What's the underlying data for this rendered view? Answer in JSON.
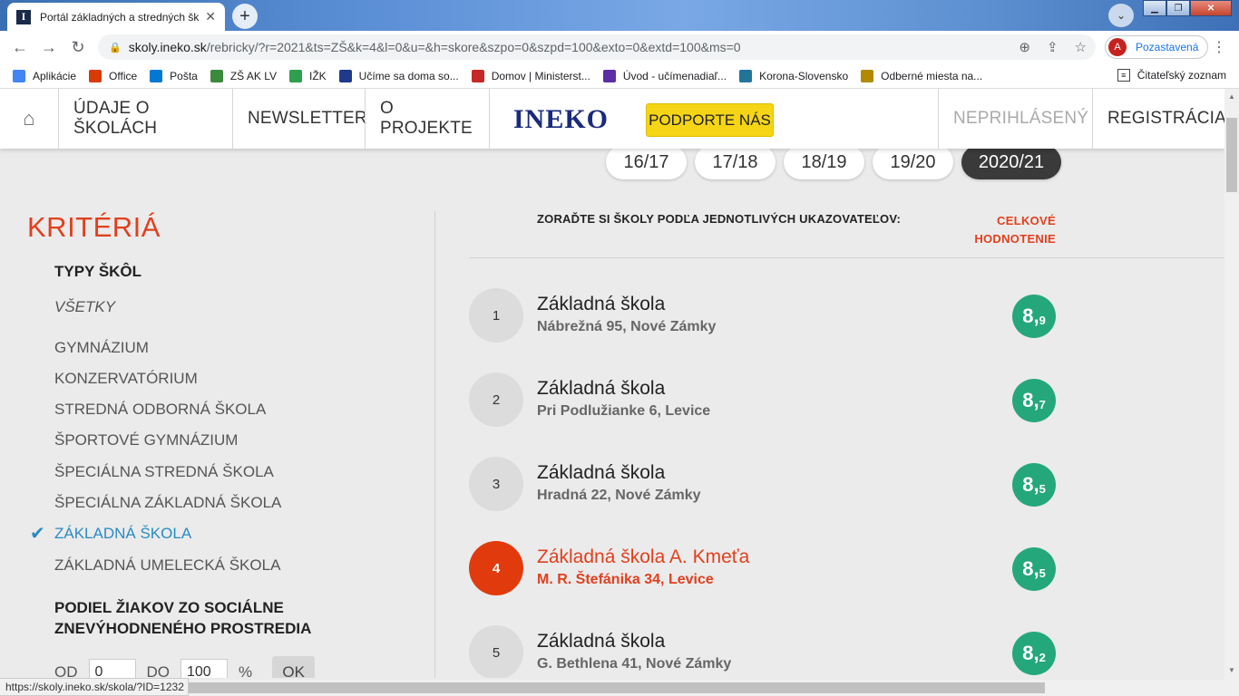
{
  "browser": {
    "tab_title": "Portál základných a stredných šk",
    "tab_favicon": "I",
    "url_host": "skoly.ineko.sk",
    "url_rest": "/rebricky/?r=2021&ts=ZŠ&k=4&l=0&u=&h=skore&szpo=0&szpd=100&exto=0&extd=100&ms=0",
    "profile_initial": "A",
    "profile_label": "Pozastavená",
    "bookmarks": [
      {
        "label": "Aplikácie",
        "icon": "apps-grid-icon",
        "color": "#4285f4"
      },
      {
        "label": "Office",
        "icon": "office-icon",
        "color": "#d83b01"
      },
      {
        "label": "Pošta",
        "icon": "outlook-icon",
        "color": "#0078d4"
      },
      {
        "label": "ZŠ AK LV",
        "icon": "school-logo-icon",
        "color": "#3c8a3c"
      },
      {
        "label": "IŽK",
        "icon": "izk-icon",
        "color": "#2e9e4f"
      },
      {
        "label": "Učíme sa doma so...",
        "icon": "globe-icon",
        "color": "#1f3a8a"
      },
      {
        "label": "Domov | Ministerst...",
        "icon": "sk-emblem-icon",
        "color": "#c62828"
      },
      {
        "label": "Úvod - učímenadiaľ...",
        "icon": "u-circle-icon",
        "color": "#5b2ea6"
      },
      {
        "label": "Korona-Slovensko",
        "icon": "wordpress-icon",
        "color": "#21759b"
      },
      {
        "label": "Odberné miesta na...",
        "icon": "crest-icon",
        "color": "#b08a00"
      }
    ],
    "reading_list": "Čitateľský zoznam",
    "status_url": "https://skoly.ineko.sk/skola/?ID=1232"
  },
  "header": {
    "nav": [
      "ÚDAJE O ŠKOLÁCH",
      "NEWSLETTER",
      "O PROJEKTE"
    ],
    "logo": "INEKO",
    "support_label": "PODPORTE NÁS",
    "login_status": "NEPRIHLÁSENÝ",
    "register_label": "REGISTRÁCIA"
  },
  "years": [
    "16/17",
    "17/18",
    "18/19",
    "19/20",
    "2020/21"
  ],
  "active_year": "2020/21",
  "sidebar": {
    "title": "KRITÉRIÁ",
    "types_heading": "TYPY ŠKÔL",
    "types": [
      {
        "label": "VŠETKY",
        "style": "italic"
      },
      {
        "label": "GYMNÁZIUM"
      },
      {
        "label": "KONZERVATÓRIUM"
      },
      {
        "label": "STREDNÁ ODBORNÁ ŠKOLA"
      },
      {
        "label": "ŠPORTOVÉ GYMNÁZIUM"
      },
      {
        "label": "ŠPECIÁLNA STREDNÁ ŠKOLA"
      },
      {
        "label": "ŠPECIÁLNA ZÁKLADNÁ ŠKOLA"
      },
      {
        "label": "ZÁKLADNÁ ŠKOLA",
        "checked": true
      },
      {
        "label": "ZÁKLADNÁ UMELECKÁ ŠKOLA"
      }
    ],
    "social_heading_line1": "PODIEL ŽIAKOV ZO SOCIÁLNE",
    "social_heading_line2": "ZNEVÝHODNENÉHO PROSTREDIA",
    "from_label": "OD",
    "from_value": "0",
    "to_label": "DO",
    "to_value": "100",
    "unit": "%",
    "ok_label": "OK"
  },
  "results": {
    "sort_label": "ZORAĎTE SI ŠKOLY PODĽA JEDNOTLIVÝCH UKAZOVATEĽOV:",
    "overall_line1": "CELKOVÉ",
    "overall_line2": "HODNOTENIE",
    "rows": [
      {
        "rank": "1",
        "name": "Základná škola",
        "address": "Nábrežná 95, Nové Zámky",
        "score_int": "8,",
        "score_dec": "9"
      },
      {
        "rank": "2",
        "name": "Základná škola",
        "address": "Pri Podlužianke 6, Levice",
        "score_int": "8,",
        "score_dec": "7"
      },
      {
        "rank": "3",
        "name": "Základná škola",
        "address": "Hradná 22, Nové Zámky",
        "score_int": "8,",
        "score_dec": "5"
      },
      {
        "rank": "4",
        "name": "Základná škola A. Kmeťa",
        "address": "M. R. Štefánika 34, Levice",
        "score_int": "8,",
        "score_dec": "5",
        "highlight": true
      },
      {
        "rank": "5",
        "name": "Základná škola",
        "address": "G. Bethlena 41, Nové Zámky",
        "score_int": "8,",
        "score_dec": "2"
      }
    ]
  },
  "colors": {
    "accent": "#e0401e",
    "score": "#25a77c",
    "check": "#2a8bc2",
    "support": "#f5d515"
  }
}
